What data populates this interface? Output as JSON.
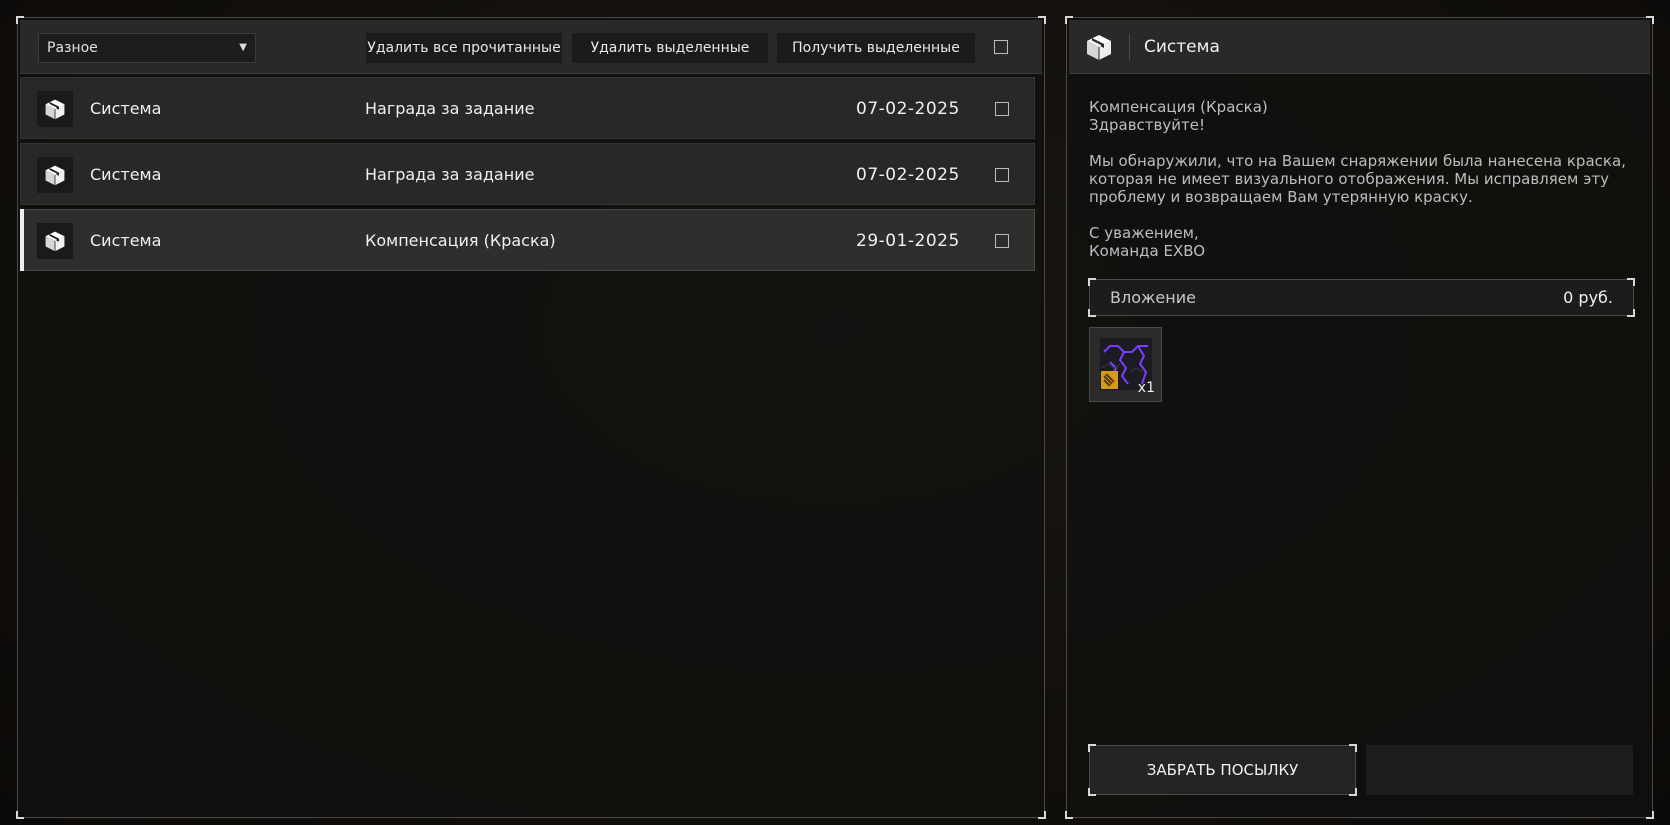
{
  "toolbar": {
    "category_selected": "Разное",
    "delete_read_label": "Удалить все прочитанные",
    "delete_selected_label": "Удалить выделенные",
    "receive_selected_label": "Получить выделенные"
  },
  "messages": [
    {
      "sender": "Система",
      "subject": "Награда за задание",
      "date": "07-02-2025",
      "selected": false,
      "icon": "package-icon"
    },
    {
      "sender": "Система",
      "subject": "Награда за задание",
      "date": "07-02-2025",
      "selected": false,
      "icon": "package-icon"
    },
    {
      "sender": "Система",
      "subject": "Компенсация (Краска)",
      "date": "29-01-2025",
      "selected": true,
      "icon": "package-icon"
    }
  ],
  "detail": {
    "sender": "Система",
    "icon": "package-icon",
    "body": "Компенсация (Краска)\nЗдравствуйте!\n\nМы обнаружили, что на Вашем снаряжении была нанесена краска,\nкоторая не имеет визуального отображения. Мы исправляем эту\nпроблему и возвращаем Вам утерянную краску.\n\nС уважением,\nКоманда EXBO",
    "attachment_label": "Вложение",
    "attachment_price": "0  руб.",
    "item": {
      "icon": "paint-icon",
      "count": "x1"
    },
    "take_button_label": "ЗАБРАТЬ ПОСЫЛКУ"
  },
  "colors": {
    "accent_purple": "#7a3cff",
    "item_badge_orange": "#d89a1c",
    "selected_indicator": "#f0f0f0"
  }
}
